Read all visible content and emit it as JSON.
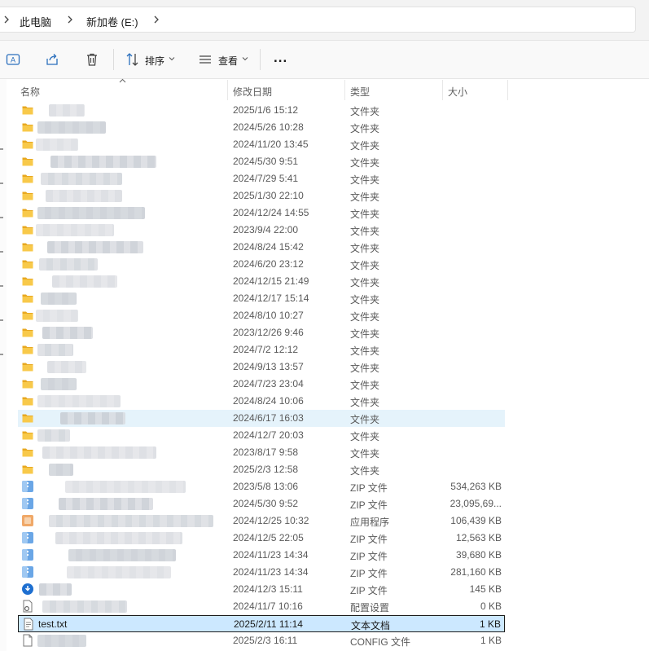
{
  "breadcrumb": {
    "items": [
      "此电脑",
      "新加卷 (E:)"
    ]
  },
  "toolbar": {
    "sort_label": "排序",
    "view_label": "查看",
    "more_label": "..."
  },
  "columns": {
    "name": "名称",
    "date": "修改日期",
    "type": "类型",
    "size": "大小"
  },
  "colors": {
    "hover": "#e5f3fb",
    "selected": "#cce8ff",
    "folder": "#f8c94a",
    "accent": "#0067c0"
  },
  "rows": [
    {
      "icon": "folder-icon",
      "name": "",
      "date": "2025/1/6 15:12",
      "type": "文件夹",
      "size": ""
    },
    {
      "icon": "folder-icon",
      "name": "",
      "date": "2024/5/26 10:28",
      "type": "文件夹",
      "size": ""
    },
    {
      "icon": "folder-icon",
      "name": "",
      "date": "2024/11/20 13:45",
      "type": "文件夹",
      "size": ""
    },
    {
      "icon": "folder-icon",
      "name": "",
      "date": "2024/5/30 9:51",
      "type": "文件夹",
      "size": ""
    },
    {
      "icon": "folder-icon",
      "name": "",
      "date": "2024/7/29 5:41",
      "type": "文件夹",
      "size": ""
    },
    {
      "icon": "folder-icon",
      "name": "",
      "date": "2025/1/30 22:10",
      "type": "文件夹",
      "size": ""
    },
    {
      "icon": "folder-icon",
      "name": "",
      "date": "2024/12/24 14:55",
      "type": "文件夹",
      "size": ""
    },
    {
      "icon": "folder-icon",
      "name": "",
      "date": "2023/9/4 22:00",
      "type": "文件夹",
      "size": ""
    },
    {
      "icon": "folder-icon",
      "name": "",
      "date": "2024/8/24 15:42",
      "type": "文件夹",
      "size": ""
    },
    {
      "icon": "folder-icon",
      "name": "",
      "date": "2024/6/20 23:12",
      "type": "文件夹",
      "size": ""
    },
    {
      "icon": "folder-icon",
      "name": "",
      "date": "2024/12/15 21:49",
      "type": "文件夹",
      "size": ""
    },
    {
      "icon": "folder-icon",
      "name": "",
      "date": "2024/12/17 15:14",
      "type": "文件夹",
      "size": ""
    },
    {
      "icon": "folder-icon",
      "name": "",
      "date": "2024/8/10 10:27",
      "type": "文件夹",
      "size": ""
    },
    {
      "icon": "folder-icon",
      "name": "",
      "date": "2023/12/26 9:46",
      "type": "文件夹",
      "size": ""
    },
    {
      "icon": "folder-icon",
      "name": "",
      "date": "2024/7/2 12:12",
      "type": "文件夹",
      "size": ""
    },
    {
      "icon": "folder-icon",
      "name": "",
      "date": "2024/9/13 13:57",
      "type": "文件夹",
      "size": ""
    },
    {
      "icon": "folder-icon",
      "name": "",
      "date": "2024/7/23 23:04",
      "type": "文件夹",
      "size": ""
    },
    {
      "icon": "folder-icon",
      "name": "",
      "date": "2024/8/24 10:06",
      "type": "文件夹",
      "size": ""
    },
    {
      "icon": "folder-icon",
      "name": "",
      "date": "2024/6/17 16:03",
      "type": "文件夹",
      "size": "",
      "state": "hover"
    },
    {
      "icon": "folder-icon",
      "name": "",
      "date": "2024/12/7 20:03",
      "type": "文件夹",
      "size": ""
    },
    {
      "icon": "folder-icon",
      "name": "",
      "date": "2023/8/17 9:58",
      "type": "文件夹",
      "size": ""
    },
    {
      "icon": "folder-icon",
      "name": "",
      "date": "2025/2/3 12:58",
      "type": "文件夹",
      "size": ""
    },
    {
      "icon": "zip-icon",
      "name": "",
      "date": "2023/5/8 13:06",
      "type": "ZIP 文件",
      "size": "534,263 KB"
    },
    {
      "icon": "zip-icon",
      "name": "",
      "date": "2024/5/30 9:52",
      "type": "ZIP 文件",
      "size": "23,095,69..."
    },
    {
      "icon": "app-icon",
      "name": "",
      "date": "2024/12/25 10:32",
      "type": "应用程序",
      "size": "106,439 KB"
    },
    {
      "icon": "zip-icon",
      "name": "",
      "date": "2024/12/5 22:05",
      "type": "ZIP 文件",
      "size": "12,563 KB"
    },
    {
      "icon": "zip-icon",
      "name": "",
      "date": "2024/11/23 14:34",
      "type": "ZIP 文件",
      "size": "39,680 KB"
    },
    {
      "icon": "zip-icon",
      "name": "",
      "date": "2024/11/23 14:34",
      "type": "ZIP 文件",
      "size": "281,160 KB"
    },
    {
      "icon": "blue-circle-icon",
      "name": "",
      "date": "2024/12/3 15:11",
      "type": "ZIP 文件",
      "size": "145 KB"
    },
    {
      "icon": "settings-file-icon",
      "name": "",
      "date": "2024/11/7 10:16",
      "type": "配置设置",
      "size": "0 KB"
    },
    {
      "icon": "text-file-icon",
      "name": "test.txt",
      "date": "2025/2/11 11:14",
      "type": "文本文档",
      "size": "1 KB",
      "state": "selected"
    },
    {
      "icon": "file-icon",
      "name": "",
      "date": "2025/2/3 16:11",
      "type": "CONFIG 文件",
      "size": "1 KB"
    }
  ]
}
